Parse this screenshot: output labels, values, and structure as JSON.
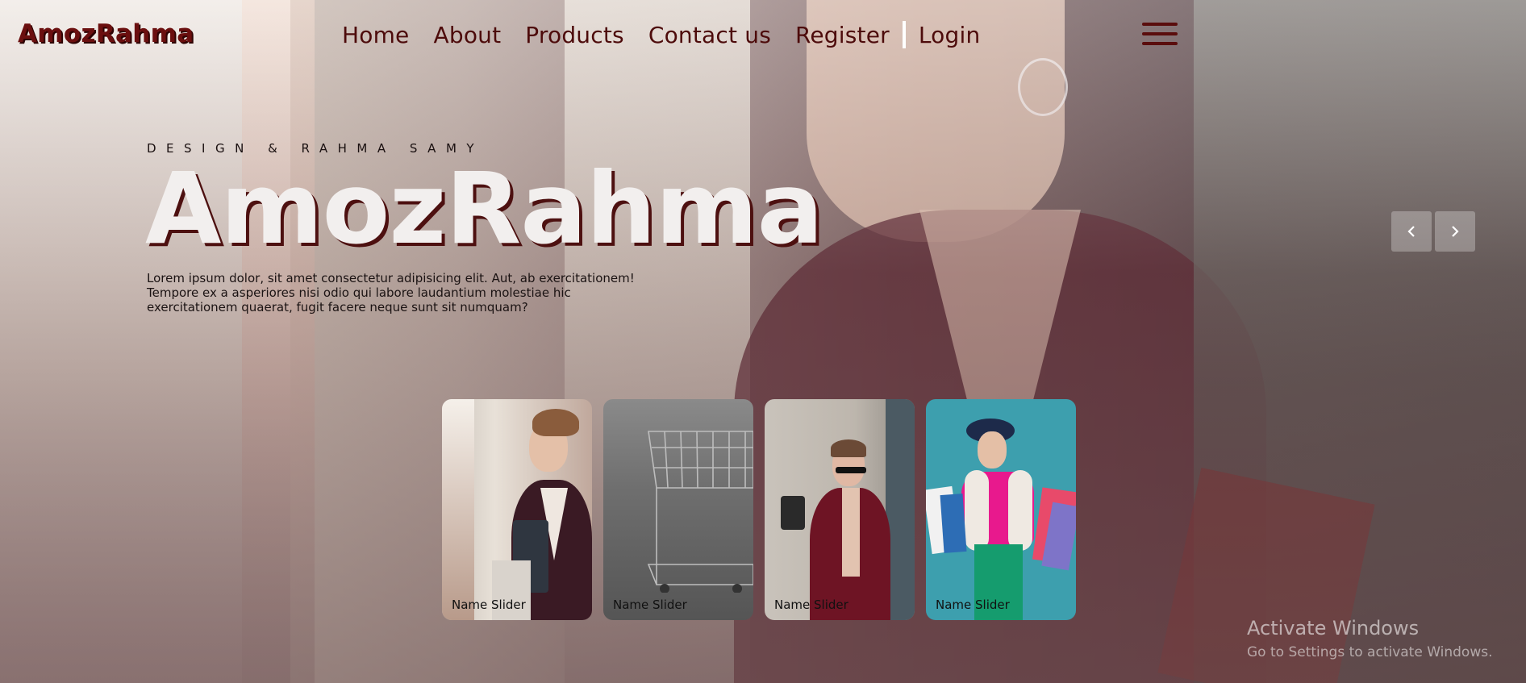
{
  "brand": {
    "name": "AmozRahma"
  },
  "nav": {
    "items": [
      "Home",
      "About",
      "Products",
      "Contact us",
      "Register"
    ],
    "login": "Login"
  },
  "icons": {
    "menu": "hamburger-icon",
    "prev": "chevron-left-icon",
    "next": "chevron-right-icon"
  },
  "hero": {
    "eyebrow": "DESIGN & RAHMA SAMY",
    "title": "AmozRahma",
    "text_line1": "Lorem ipsum dolor, sit amet consectetur adipisicing elit. Aut, ab exercitationem!",
    "text_line2": "Tempore ex a asperiores nisi odio qui labore laudantium molestiae hic",
    "text_line3": "exercitationem quaerat, fugit facere neque sunt sit numquam?"
  },
  "slider": {
    "items": [
      {
        "caption": "Name Slider"
      },
      {
        "caption": "Name Slider"
      },
      {
        "caption": "Name Slider"
      },
      {
        "caption": "Name Slider"
      }
    ]
  },
  "watermark": {
    "title": "Activate Windows",
    "subtitle": "Go to Settings to activate Windows."
  },
  "colors": {
    "brand": "#6b0f0f",
    "nav_text": "#4d0b0b",
    "headline": "#f2efee"
  }
}
